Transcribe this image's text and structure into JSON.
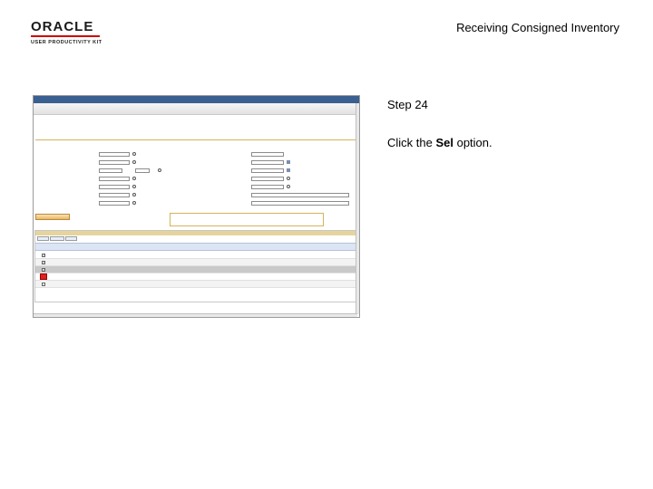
{
  "header": {
    "logo_word": "ORACLE",
    "logo_sub": "USER PRODUCTIVITY KIT",
    "document_title": "Receiving Consigned Inventory"
  },
  "step": {
    "title": "Step 24",
    "instruction_prefix": "Click the ",
    "instruction_bold": "Sel",
    "instruction_suffix": " option."
  },
  "colors": {
    "highlight": "#e02020",
    "nav": "#3a5f91",
    "brand": "#cc0000"
  }
}
